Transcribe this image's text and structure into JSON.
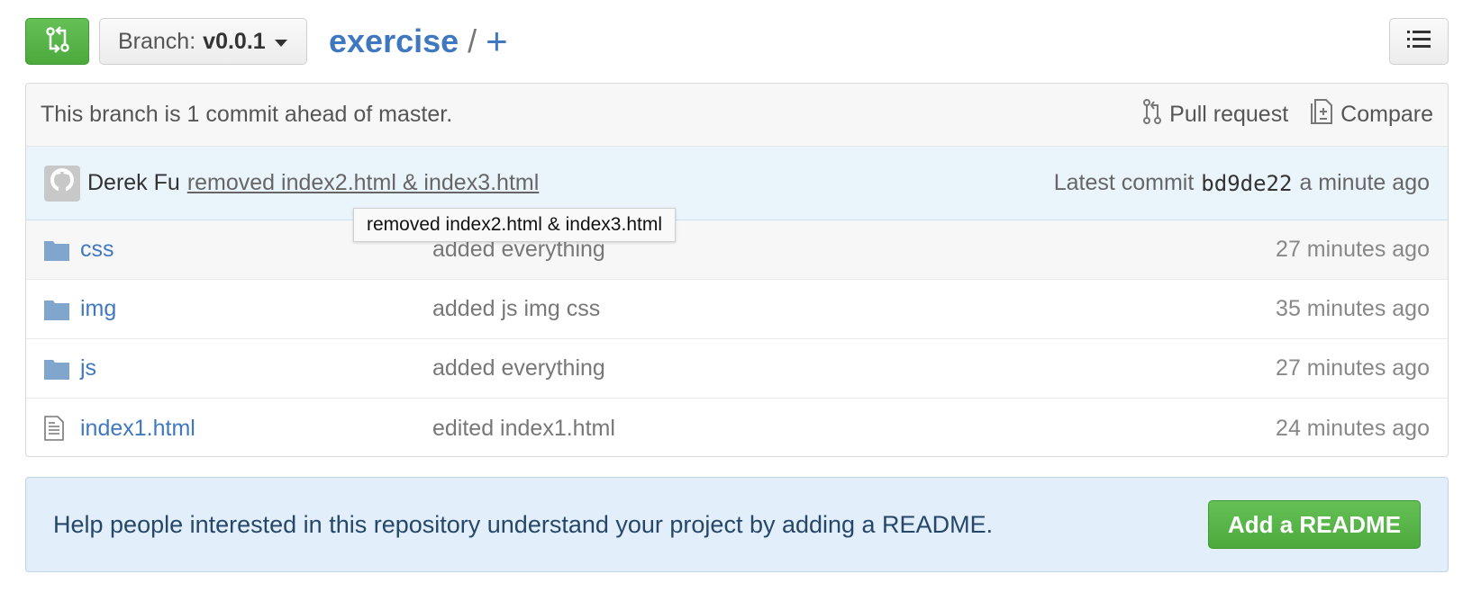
{
  "toolbar": {
    "branch_prefix": "Branch:",
    "branch_name": "v0.0.1",
    "repo_name": "exercise",
    "separator": "/",
    "new_file": "+"
  },
  "branch_info": {
    "message": "This branch is 1 commit ahead of master.",
    "pull_request": "Pull request",
    "compare": "Compare"
  },
  "latest_commit": {
    "author": "Derek Fu",
    "message": "removed index2.html & index3.html",
    "label": "Latest commit",
    "sha": "bd9de22",
    "age": "a minute ago",
    "tooltip": "removed index2.html & index3.html"
  },
  "files": [
    {
      "icon": "folder-icon",
      "name": "css",
      "message": "added everything",
      "age": "27 minutes ago"
    },
    {
      "icon": "folder-icon",
      "name": "img",
      "message": "added js img css",
      "age": "35 minutes ago"
    },
    {
      "icon": "folder-icon",
      "name": "js",
      "message": "added everything",
      "age": "27 minutes ago"
    },
    {
      "icon": "file-icon",
      "name": "index1.html",
      "message": "edited index1.html",
      "age": "24 minutes ago"
    }
  ],
  "readme": {
    "message": "Help people interested in this repository understand your project by adding a README.",
    "button": "Add a README"
  },
  "colors": {
    "link": "#4078c0",
    "green_button": "#55b145",
    "commit_bg": "#eaf4fb",
    "readme_bg": "#e2eef9"
  }
}
